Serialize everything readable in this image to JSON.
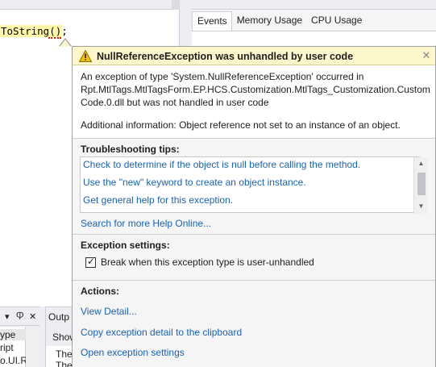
{
  "editor": {
    "code_line": "ToString();"
  },
  "diagnostics": {
    "tabs": [
      {
        "label": "Events"
      },
      {
        "label": "Memory Usage"
      },
      {
        "label": "CPU Usage"
      }
    ]
  },
  "tool_window_left": {
    "buttons": [
      "▾",
      "Ⴔ",
      "✕"
    ],
    "items": [
      "ype",
      "ript",
      "o.UI.Rp"
    ]
  },
  "output_window": {
    "title": "Outp",
    "show_label": "Show",
    "lines": [
      "The",
      "The"
    ]
  },
  "exception": {
    "title": "NullReferenceException was unhandled by user code",
    "close_glyph": "✕",
    "description": "An exception of type 'System.NullReferenceException' occurred in Rpt.MtlTags.MtlTagsForm.EP.HCS.Customization.MtlTags_Customization.Custom Code.0.dll but was not handled in user code",
    "additional_info": "Additional information: Object reference not set to an instance of an object.",
    "colors": {
      "header_bg": "#fff7cc",
      "link": "#1a62b6",
      "warning": "#f2c200"
    },
    "troubleshooting": {
      "title": "Troubleshooting tips:",
      "tips": [
        "Check to determine if the object is null before calling the method.",
        "Use the \"new\" keyword to create an object instance.",
        "Get general help for this exception."
      ],
      "search_link": "Search for more Help Online..."
    },
    "settings": {
      "title": "Exception settings:",
      "checkbox_label": "Break when this exception type is user-unhandled",
      "checked": true
    },
    "actions": {
      "title": "Actions:",
      "items": [
        "View Detail...",
        "Copy exception detail to the clipboard",
        "Open exception settings"
      ]
    }
  }
}
